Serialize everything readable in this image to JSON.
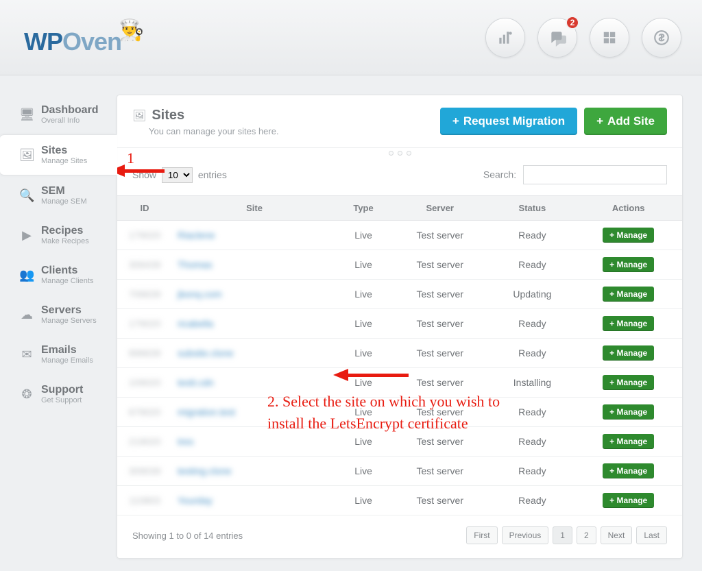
{
  "brand": {
    "part1": "WP",
    "part2": "Oven"
  },
  "top_badge": "2",
  "sidebar": [
    {
      "title": "Dashboard",
      "sub": "Overall Info",
      "icon": "⬚"
    },
    {
      "title": "Sites",
      "sub": "Manage Sites",
      "icon": "🖼"
    },
    {
      "title": "SEM",
      "sub": "Manage SEM",
      "icon": "🔍"
    },
    {
      "title": "Recipes",
      "sub": "Make Recipes",
      "icon": "▶"
    },
    {
      "title": "Clients",
      "sub": "Manage Clients",
      "icon": "👥"
    },
    {
      "title": "Servers",
      "sub": "Manage Servers",
      "icon": "☁"
    },
    {
      "title": "Emails",
      "sub": "Manage Emails",
      "icon": "✉"
    },
    {
      "title": "Support",
      "sub": "Get Support",
      "icon": "❂"
    }
  ],
  "page": {
    "title": "Sites",
    "subtitle": "You can manage your sites here.",
    "btn_migration": "Request Migration",
    "btn_addsite": "Add Site"
  },
  "table": {
    "show_label_pre": "Show",
    "show_label_post": "entries",
    "show_value": "10",
    "search_label": "Search:",
    "cols": {
      "id": "ID",
      "site": "Site",
      "type": "Type",
      "server": "Server",
      "status": "Status",
      "actions": "Actions"
    },
    "manage_label": "Manage",
    "rows": [
      {
        "id": "179020",
        "site": "Riaclene",
        "type": "Live",
        "server": "Test server",
        "status": "Ready"
      },
      {
        "id": "306439",
        "site": "Thomas",
        "type": "Live",
        "server": "Test server",
        "status": "Ready"
      },
      {
        "id": "706639",
        "site": "jbonq.com",
        "type": "Live",
        "server": "Test server",
        "status": "Updating"
      },
      {
        "id": "179020",
        "site": "ricabella",
        "type": "Live",
        "server": "Test server",
        "status": "Ready"
      },
      {
        "id": "896639",
        "site": "subsite.clone",
        "type": "Live",
        "server": "Test server",
        "status": "Ready"
      },
      {
        "id": "109020",
        "site": "testt.cdn",
        "type": "Live",
        "server": "Test server",
        "status": "Installing"
      },
      {
        "id": "679020",
        "site": "migration.test",
        "type": "Live",
        "server": "Test server",
        "status": "Ready"
      },
      {
        "id": "219020",
        "site": "tres",
        "type": "Live",
        "server": "Test server",
        "status": "Ready"
      },
      {
        "id": "309039",
        "site": "testing.clone",
        "type": "Live",
        "server": "Test server",
        "status": "Ready"
      },
      {
        "id": "110803",
        "site": "Yourday",
        "type": "Live",
        "server": "Test server",
        "status": "Ready"
      }
    ],
    "footer_info": "Showing 1 to 0 of 14 entries",
    "pager": {
      "first": "First",
      "prev": "Previous",
      "p1": "1",
      "p2": "2",
      "next": "Next",
      "last": "Last"
    }
  },
  "annotations": {
    "n1": "1",
    "n2": "2. Select the site on which you wish to install the LetsEncrypt certificate"
  }
}
